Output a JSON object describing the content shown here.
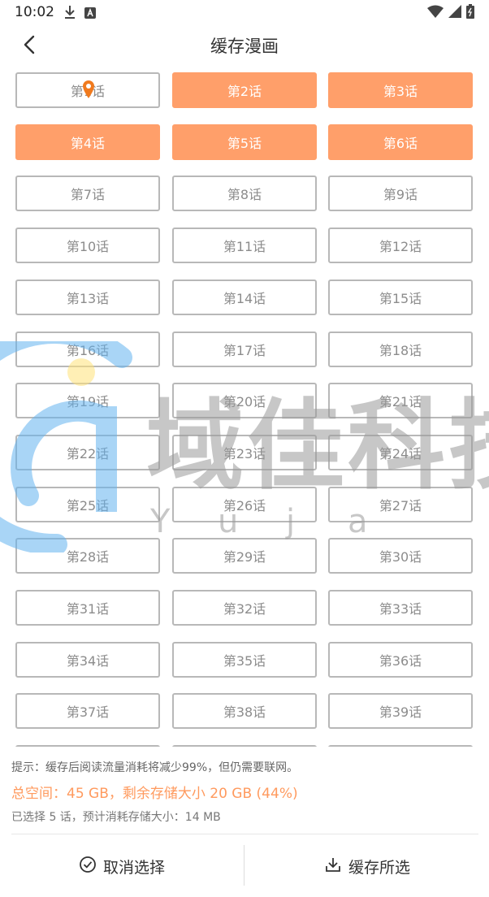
{
  "status_bar": {
    "time": "10:02",
    "left_icons": [
      "download-icon",
      "a-icon"
    ],
    "right_icons": [
      "wifi-icon",
      "signal-icon",
      "battery-icon"
    ]
  },
  "header": {
    "title": "缓存漫画",
    "back_icon": "chevron-left-icon"
  },
  "colors": {
    "accent": "#ff9f6a",
    "accent_text": "#ff9a5e",
    "border": "#b8b8b8",
    "chapter_text": "#8c8c8c"
  },
  "chapters": [
    {
      "label": "第1话",
      "selected": false
    },
    {
      "label": "第2话",
      "selected": true
    },
    {
      "label": "第3话",
      "selected": true
    },
    {
      "label": "第4话",
      "selected": true
    },
    {
      "label": "第5话",
      "selected": true
    },
    {
      "label": "第6话",
      "selected": true
    },
    {
      "label": "第7话",
      "selected": false
    },
    {
      "label": "第8话",
      "selected": false
    },
    {
      "label": "第9话",
      "selected": false
    },
    {
      "label": "第10话",
      "selected": false
    },
    {
      "label": "第11话",
      "selected": false
    },
    {
      "label": "第12话",
      "selected": false
    },
    {
      "label": "第13话",
      "selected": false
    },
    {
      "label": "第14话",
      "selected": false
    },
    {
      "label": "第15话",
      "selected": false
    },
    {
      "label": "第16话",
      "selected": false
    },
    {
      "label": "第17话",
      "selected": false
    },
    {
      "label": "第18话",
      "selected": false
    },
    {
      "label": "第19话",
      "selected": false
    },
    {
      "label": "第20话",
      "selected": false
    },
    {
      "label": "第21话",
      "selected": false
    },
    {
      "label": "第22话",
      "selected": false
    },
    {
      "label": "第23话",
      "selected": false
    },
    {
      "label": "第24话",
      "selected": false
    },
    {
      "label": "第25话",
      "selected": false
    },
    {
      "label": "第26话",
      "selected": false
    },
    {
      "label": "第27话",
      "selected": false
    },
    {
      "label": "第28话",
      "selected": false
    },
    {
      "label": "第29话",
      "selected": false
    },
    {
      "label": "第30话",
      "selected": false
    },
    {
      "label": "第31话",
      "selected": false
    },
    {
      "label": "第32话",
      "selected": false
    },
    {
      "label": "第33话",
      "selected": false
    },
    {
      "label": "第34话",
      "selected": false
    },
    {
      "label": "第35话",
      "selected": false
    },
    {
      "label": "第36话",
      "selected": false
    },
    {
      "label": "第37话",
      "selected": false
    },
    {
      "label": "第38话",
      "selected": false
    },
    {
      "label": "第39话",
      "selected": false
    },
    {
      "label": "",
      "selected": false
    },
    {
      "label": "",
      "selected": false
    },
    {
      "label": "",
      "selected": false
    }
  ],
  "watermark": {
    "text": "域佳科技",
    "letters": [
      "Y",
      "u",
      "j",
      "a"
    ]
  },
  "footer": {
    "tip": "提示：缓存后阅读流量消耗将减少99%，但仍需要联网。",
    "space": "总空间：45 GB，剩余存储大小 20 GB (44%)",
    "selected_info": "已选择 5 话，预计消耗存储大小：14 MB"
  },
  "actions": {
    "cancel_label": "取消选择",
    "cancel_icon": "check-circle-icon",
    "cache_label": "缓存所选",
    "cache_icon": "download-icon"
  }
}
